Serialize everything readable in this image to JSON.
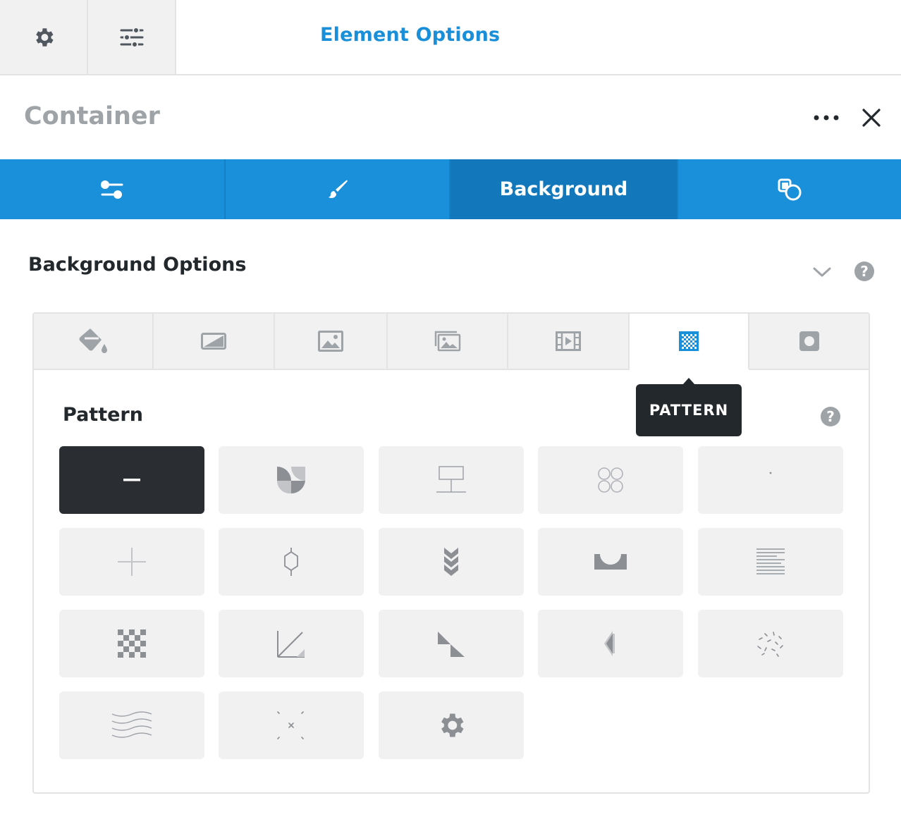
{
  "topbar": {
    "title": "Element Options",
    "buttons": [
      {
        "icon": "gear-icon"
      },
      {
        "icon": "sliders-icon"
      }
    ]
  },
  "header": {
    "element_title": "Container",
    "more_icon": "more-dots-icon",
    "close_icon": "close-icon"
  },
  "tabs": [
    {
      "icon": "toggles-icon",
      "label": ""
    },
    {
      "icon": "brush-icon",
      "label": ""
    },
    {
      "icon": "",
      "label": "Background",
      "active": true
    },
    {
      "icon": "extras-icon",
      "label": ""
    }
  ],
  "section": {
    "title": "Background Options",
    "chevron_icon": "chevron-down-icon",
    "help": "?"
  },
  "background_types": [
    {
      "icon": "paint-bucket-icon"
    },
    {
      "icon": "gradient-icon"
    },
    {
      "icon": "image-icon"
    },
    {
      "icon": "slideshow-icon"
    },
    {
      "icon": "video-icon"
    },
    {
      "icon": "pattern-icon",
      "active": true
    },
    {
      "icon": "mask-icon"
    }
  ],
  "tooltip": "PATTERN",
  "pattern": {
    "label": "Pattern",
    "help": "?",
    "tiles": [
      "none",
      "abstract",
      "bricks",
      "circles",
      "dots",
      "plus",
      "hexagon",
      "chevrons",
      "half-circle",
      "lines",
      "checkerboard",
      "diagonal",
      "triangle",
      "triangle-stripes",
      "confetti",
      "waves",
      "crosses",
      "custom"
    ],
    "selected": "none"
  },
  "colors": {
    "accent": "#1a8fda",
    "accent_dark": "#1378bb",
    "text_dark": "#23282d",
    "muted": "#9ea3a8",
    "tile_bg": "#f1f1f2"
  }
}
